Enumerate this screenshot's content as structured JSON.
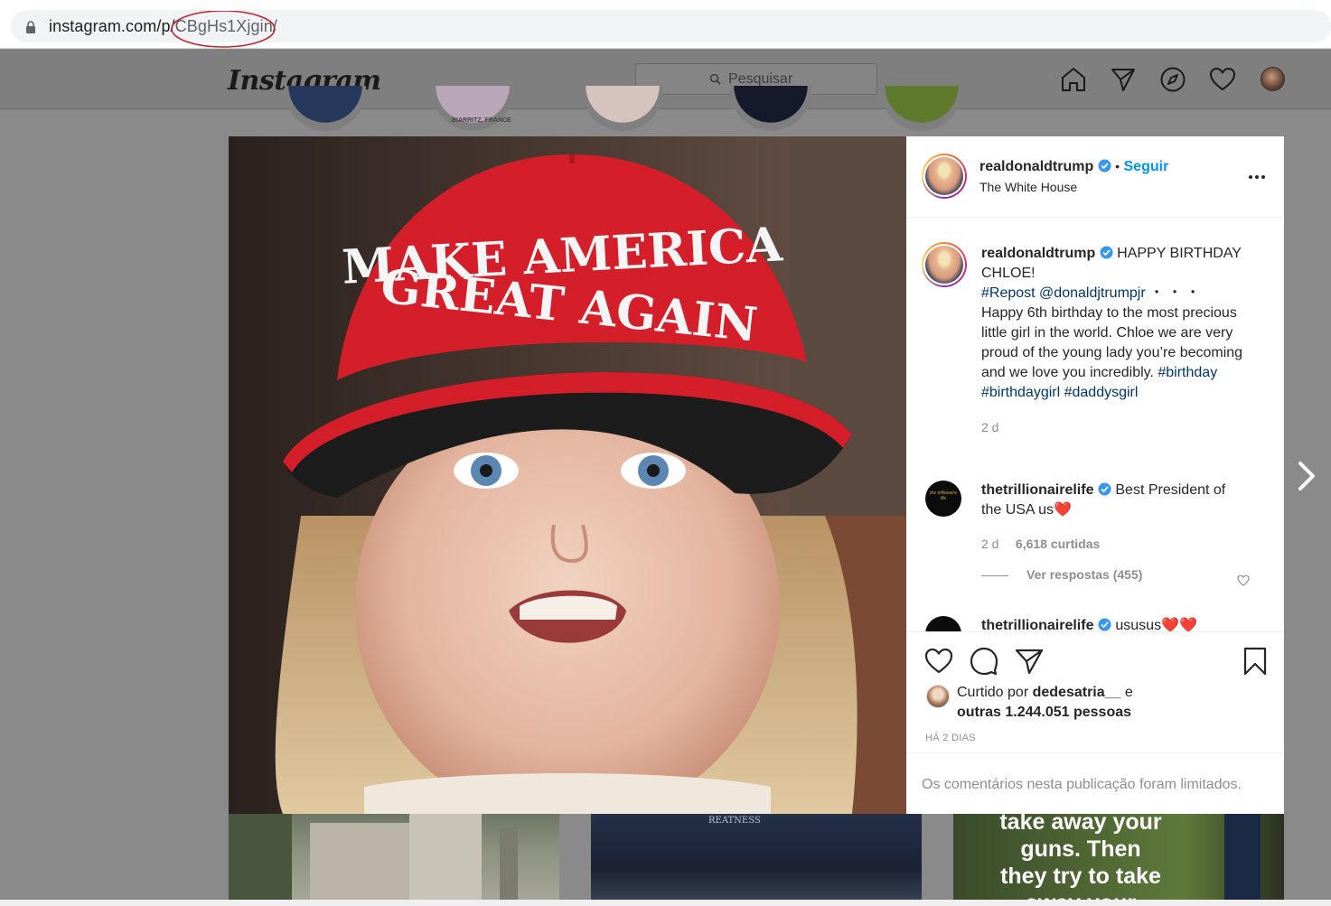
{
  "browser": {
    "url_prefix": "instagram.com/p/",
    "url_highlight": "CBgHs1Xjgin/"
  },
  "header": {
    "logo": "Instagram",
    "search_placeholder": "Pesquisar"
  },
  "stories": {
    "caption": "BIARRITZ, FRANCE"
  },
  "post": {
    "image_text": {
      "line1": "MAKE AMERICA",
      "line2": "GREAT AGAIN"
    },
    "author": {
      "username": "realdonaldtrump",
      "separator": "•",
      "follow_label": "Seguir",
      "location": "The White House"
    },
    "caption": {
      "username": "realdonaldtrump",
      "text_start": "HAPPY BIRTHDAY CHLOE!",
      "tag_repost": "#Repost",
      "mention": "@donaldjtrumpjr",
      "dots": "・・・",
      "body": "Happy 6th birthday to the most precious little girl in the world. Chloe we are very proud of the young lady you’re becoming and we love you incredibly.",
      "tag1": "#birthday",
      "tag2": "#birthdaygirl",
      "tag3": "#daddysgirl",
      "age": "2 d"
    },
    "comments": [
      {
        "username": "thetrillionairelife",
        "text": "Best President of the USA us",
        "emoji": "❤️",
        "age": "2 d",
        "likes": "6,618 curtidas",
        "replies": "Ver respostas (455)",
        "avatar_text": "the trillionaire life"
      },
      {
        "username": "thetrillionairelife",
        "text": "ususus",
        "emoji": "❤️❤️"
      }
    ],
    "likes": {
      "prefix": "Curtido por",
      "user": "dedesatria__",
      "mid": "e",
      "others": "outras 1.244.051 pessoas"
    },
    "timestamp": "HÁ 2 DIAS",
    "comments_limited": "Os comentários nesta publicação foram limitados."
  },
  "grid": {
    "tile1_text": "REATNESS",
    "tile3_lines": [
      "take away your",
      "guns. Then",
      "they try to take",
      "away your"
    ]
  },
  "colors": {
    "follow_blue": "#0095f6",
    "link_blue": "#00376b",
    "cap_red": "#d41f2a",
    "verified_blue": "#3897f0"
  }
}
